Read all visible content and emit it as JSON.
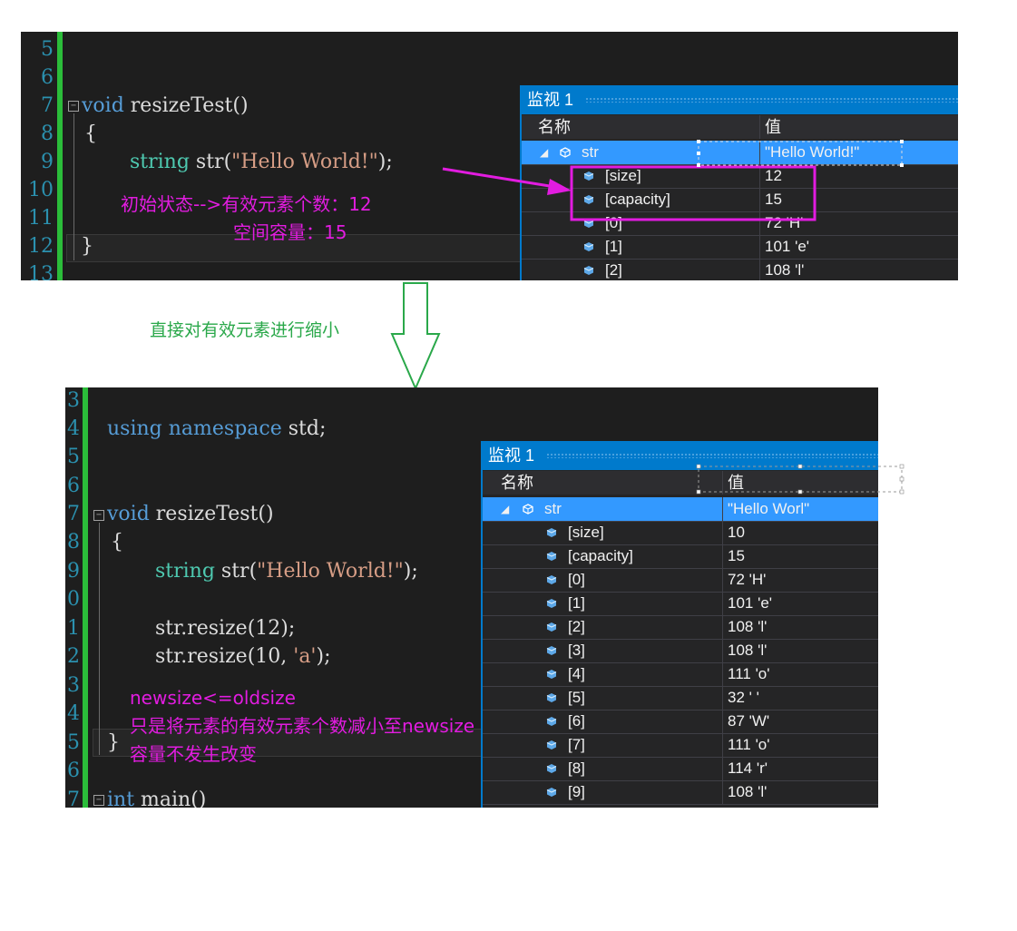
{
  "top": {
    "line_numbers": [
      "5",
      "6",
      "7",
      "8",
      "9",
      "10",
      "11",
      "12",
      "13"
    ],
    "code": {
      "l7_kw": "void",
      "l7_rest": " resizeTest()",
      "l8": "{",
      "l9_type": "string",
      "l9_mid": " str(",
      "l9_str": "\"Hello World!\"",
      "l9_end": ");",
      "l12": "}"
    },
    "annotation_1": "初始状态-->有效元素个数：12",
    "annotation_2": "空间容量：15",
    "watch": {
      "title": "监视 1",
      "col_name": "名称",
      "col_value": "值",
      "rows": [
        {
          "name": "str",
          "value": "\"Hello World!\""
        },
        {
          "name": "[size]",
          "value": "12"
        },
        {
          "name": "[capacity]",
          "value": "15"
        },
        {
          "name": "[0]",
          "value": "72 'H'"
        },
        {
          "name": "[1]",
          "value": "101 'e'"
        },
        {
          "name": "[2]",
          "value": "108 'l'"
        }
      ]
    }
  },
  "transition_label": "直接对有效元素进行缩小",
  "bottom": {
    "line_numbers": [
      "3",
      "4",
      "5",
      "6",
      "7",
      "8",
      "9",
      "0",
      "1",
      "2",
      "3",
      "4",
      "5",
      "6",
      "7"
    ],
    "code": {
      "l4_kw1": "using",
      "l4_kw2": "namespace",
      "l4_rest": " std;",
      "l7_kw": "void",
      "l7_rest": " resizeTest()",
      "l8": "{",
      "l9_type": "string",
      "l9_mid": " str(",
      "l9_str": "\"Hello World!\"",
      "l9_end": ");",
      "l11_a": "str.resize(12);",
      "l12_a": "str.resize(10, ",
      "l12_str": "'a'",
      "l12_end": ");",
      "l15": "}",
      "l17_kw": "int",
      "l17_rest": " main()"
    },
    "annotation_1": "newsize<=oldsize",
    "annotation_2": "只是将元素的有效元素个数减小至newsize",
    "annotation_3": "容量不发生改变",
    "watch": {
      "title": "监视 1",
      "col_name": "名称",
      "col_value": "值",
      "rows": [
        {
          "name": "str",
          "value": "\"Hello Worl\""
        },
        {
          "name": "[size]",
          "value": "10"
        },
        {
          "name": "[capacity]",
          "value": "15"
        },
        {
          "name": "[0]",
          "value": "72 'H'"
        },
        {
          "name": "[1]",
          "value": "101 'e'"
        },
        {
          "name": "[2]",
          "value": "108 'l'"
        },
        {
          "name": "[3]",
          "value": "108 'l'"
        },
        {
          "name": "[4]",
          "value": "111 'o'"
        },
        {
          "name": "[5]",
          "value": "32 ' '"
        },
        {
          "name": "[6]",
          "value": "87 'W'"
        },
        {
          "name": "[7]",
          "value": "111 'o'"
        },
        {
          "name": "[8]",
          "value": "114 'r'"
        },
        {
          "name": "[9]",
          "value": "108 'l'"
        }
      ]
    }
  },
  "colors": {
    "annotation": "#e21ce0",
    "arrow_green": "#2aa84a",
    "selection": "#3399ff",
    "title_bar": "#007acc",
    "gutter_green": "#2bbd3a"
  }
}
